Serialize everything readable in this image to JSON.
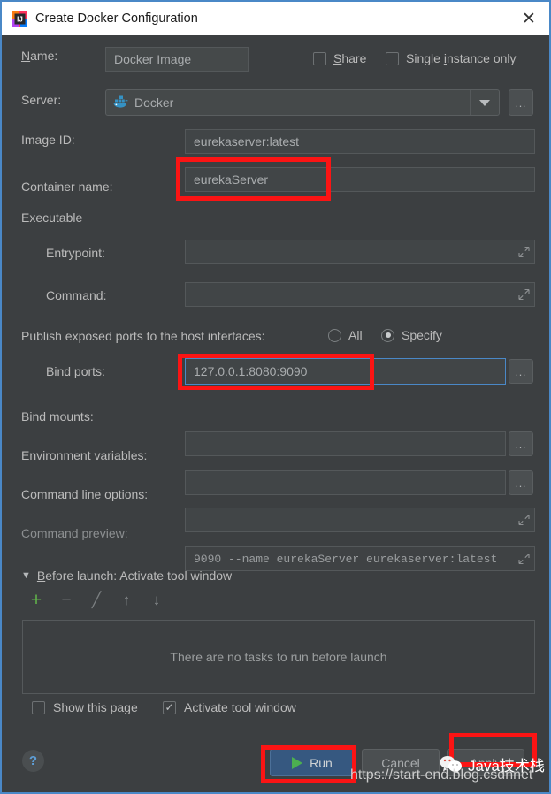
{
  "window": {
    "title": "Create Docker Configuration",
    "icon": "intellij-idea-icon",
    "close_label": "✕"
  },
  "form": {
    "name": {
      "label_prefix": "N",
      "label_rest": "ame:",
      "value": "Docker Image"
    },
    "share": {
      "label_prefix": "S",
      "label_rest": "hare",
      "checked": false
    },
    "single_instance": {
      "label_a": "Single ",
      "label_mn": "i",
      "label_b": "nstance only",
      "checked": false
    },
    "server": {
      "label": "Server:",
      "value": "Docker",
      "icon": "docker-whale-icon",
      "browse_label": "…"
    },
    "image_id": {
      "label": "Image ID:",
      "value": "eurekaserver:latest"
    },
    "container_name": {
      "label": "Container name:",
      "value": "eurekaServer"
    },
    "executable_group": "Executable",
    "entrypoint": {
      "label": "Entrypoint:",
      "value": ""
    },
    "command": {
      "label": "Command:",
      "value": ""
    },
    "publish_ports": {
      "label": "Publish exposed ports to the host interfaces:",
      "option_all": "All",
      "option_specify": "Specify",
      "selected": "Specify"
    },
    "bind_ports": {
      "label": "Bind ports:",
      "value": "127.0.0.1:8080:9090",
      "browse_label": "…"
    },
    "bind_mounts": {
      "label": "Bind mounts:",
      "value": "",
      "browse_label": "…"
    },
    "environment_variables": {
      "label": "Environment variables:",
      "value": "",
      "browse_label": "…"
    },
    "command_line_options": {
      "label": "Command line options:",
      "value": ""
    },
    "command_preview": {
      "label": "Command preview:",
      "value": "9090 --name eurekaServer eurekaserver:latest"
    }
  },
  "before_launch": {
    "collapse_icon": "▼",
    "title_prefix": "B",
    "title_rest": "efore launch: Activate tool window",
    "toolbar": [
      {
        "name": "add-task-button",
        "glyph": "+",
        "color": "#62b54a"
      },
      {
        "name": "remove-task-button",
        "glyph": "−",
        "color": "#7b7f81"
      },
      {
        "name": "edit-task-button",
        "glyph": "╱",
        "color": "#7b7f81"
      },
      {
        "name": "move-up-button",
        "glyph": "↑",
        "color": "#7b7f81"
      },
      {
        "name": "move-down-button",
        "glyph": "↓",
        "color": "#7b7f81"
      }
    ],
    "empty_text": "There are no tasks to run before launch"
  },
  "bottom": {
    "show_this_page": {
      "label": "Show this page",
      "checked": false
    },
    "activate_tool_window": {
      "label": "Activate tool window",
      "checked": true,
      "check_glyph": "✓"
    },
    "help_label": "?",
    "run_button": "Run",
    "cancel_button": "Cancel",
    "apply_button": "Apply"
  },
  "watermark": {
    "url": "https://start-end.blog.csdnnet",
    "brand": "Java技术栈"
  },
  "colors": {
    "accent_blue": "#4a88c7",
    "annotation_red": "#fb1414",
    "run_button_blue": "#365880",
    "play_green": "#4caf50",
    "add_green": "#62b54a",
    "panel_bg": "#3c3f41",
    "field_bg": "#45494a",
    "title_bg": "#ffffff"
  }
}
